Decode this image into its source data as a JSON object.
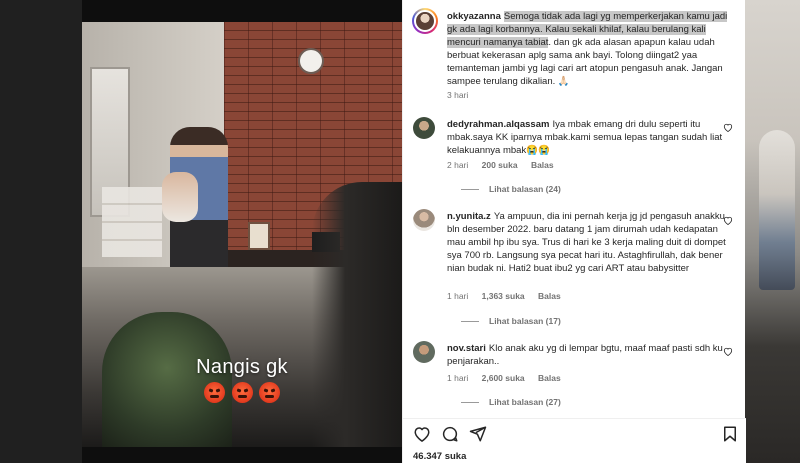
{
  "media": {
    "caption": "Nangis gk",
    "emoji_icon": "angry-face-icon"
  },
  "post": {
    "username": "okkyazanna",
    "caption_highlighted": "Semoga tidak ada lagi yg memperkerjakan kamu jadi gk ada lagi korbannya. Kalau sekali khilaf, kalau berulang kali mencuri namanya tabiat",
    "caption_rest": ". dan gk ada alasan apapun kalau udah berbuat kekerasan aplg sama ank bayi. Tolong diingat2 yaa temanteman jambi yg lagi cari art atopun pengasuh anak. Jangan sampee terulang dikalian. 🙏🏻",
    "time": "3 hari"
  },
  "comments": [
    {
      "username": "dedyrahman.alqassam",
      "text": "Iya mbak emang dri dulu seperti itu mbak.saya KK iparnya mbak.kami semua lepas tangan sudah liat kelakuannya mbak😭😭",
      "time": "2 hari",
      "likes": "200 suka",
      "reply": "Balas",
      "view_replies": "Lihat balasan (24)"
    },
    {
      "username": "n.yunita.z",
      "text": "Ya ampuun, dia ini pernah kerja jg jd pengasuh anakku bln desember 2022. baru datang 1 jam dirumah udah kedapatan mau ambil hp ibu sya. Trus di hari ke 3 kerja maling duit di dompet sya 700 rb. Langsung sya pecat hari itu. Astaghfirullah, dak bener nian budak ni. Hati2 buat ibu2 yg cari ART atau babysitter",
      "time": "1 hari",
      "likes": "1,363 suka",
      "reply": "Balas",
      "view_replies": "Lihat balasan (17)"
    },
    {
      "username": "nov.stari",
      "text": "Klo anak aku yg di lempar bgtu, maaf maaf pasti sdh ku penjarakan..",
      "time": "1 hari",
      "likes": "2,600 suka",
      "reply": "Balas",
      "view_replies": "Lihat balasan (27)"
    }
  ],
  "footer": {
    "likes": "46.347 suka"
  },
  "icons": {
    "like": "heart-icon",
    "comment": "comment-icon",
    "share": "share-icon",
    "save": "bookmark-icon"
  }
}
